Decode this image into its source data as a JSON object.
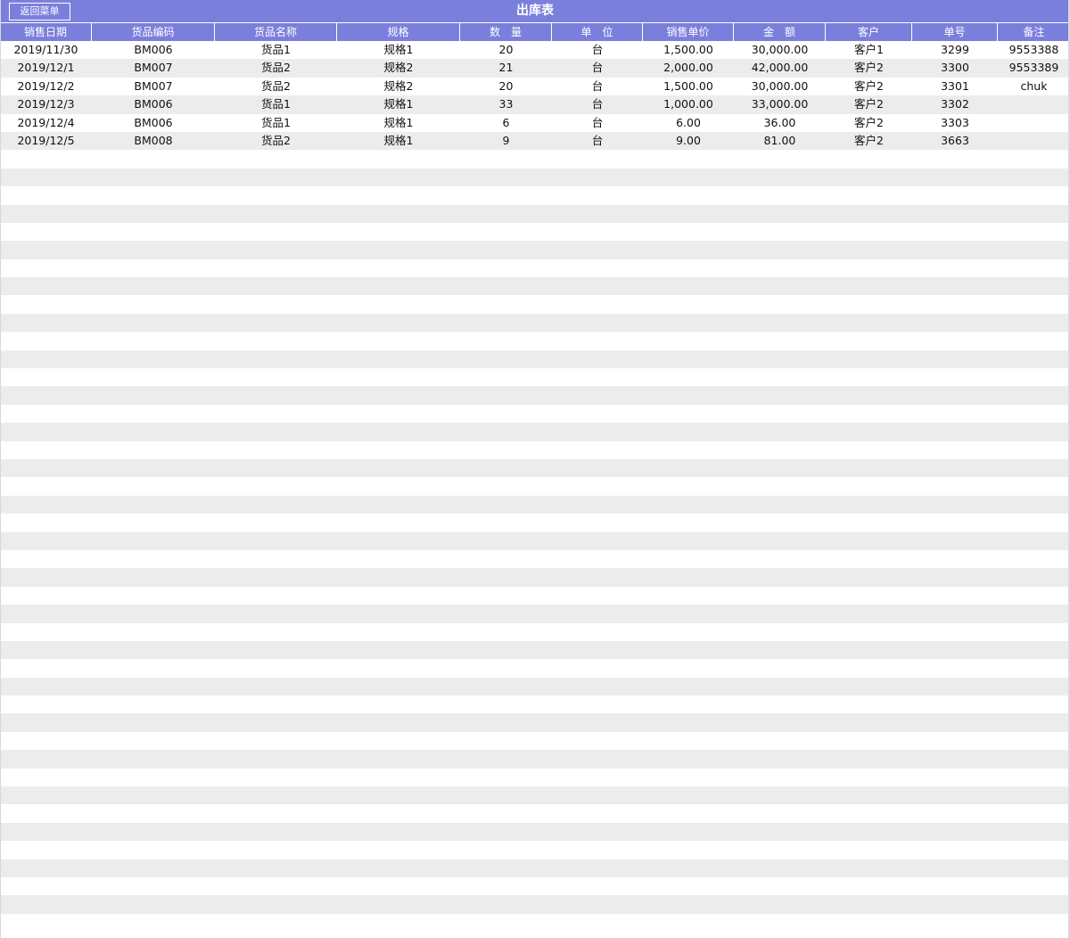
{
  "window": {
    "title": "出库表",
    "back_button": "返回菜单"
  },
  "table": {
    "headers": [
      "销售日期",
      "货品编码",
      "货品名称",
      "规格",
      "数　量",
      "单　位",
      "销售单价",
      "金　额",
      "客户",
      "单号",
      "备注"
    ],
    "rows": [
      [
        "2019/11/30",
        "BM006",
        "货品1",
        "规格1",
        "20",
        "台",
        "1,500.00",
        "30,000.00",
        "客户1",
        "3299",
        "9553388"
      ],
      [
        "2019/12/1",
        "BM007",
        "货品2",
        "规格2",
        "21",
        "台",
        "2,000.00",
        "42,000.00",
        "客户2",
        "3300",
        "9553389"
      ],
      [
        "2019/12/2",
        "BM007",
        "货品2",
        "规格2",
        "20",
        "台",
        "1,500.00",
        "30,000.00",
        "客户2",
        "3301",
        "chuk"
      ],
      [
        "2019/12/3",
        "BM006",
        "货品1",
        "规格1",
        "33",
        "台",
        "1,000.00",
        "33,000.00",
        "客户2",
        "3302",
        ""
      ],
      [
        "2019/12/4",
        "BM006",
        "货品1",
        "规格1",
        "6",
        "台",
        "6.00",
        "36.00",
        "客户2",
        "3303",
        ""
      ],
      [
        "2019/12/5",
        "BM008",
        "货品2",
        "规格1",
        "9",
        "台",
        "9.00",
        "81.00",
        "客户2",
        "3663",
        ""
      ]
    ]
  },
  "colors": {
    "header_bg": "#7b7fdc",
    "stripe": "#ececec"
  }
}
